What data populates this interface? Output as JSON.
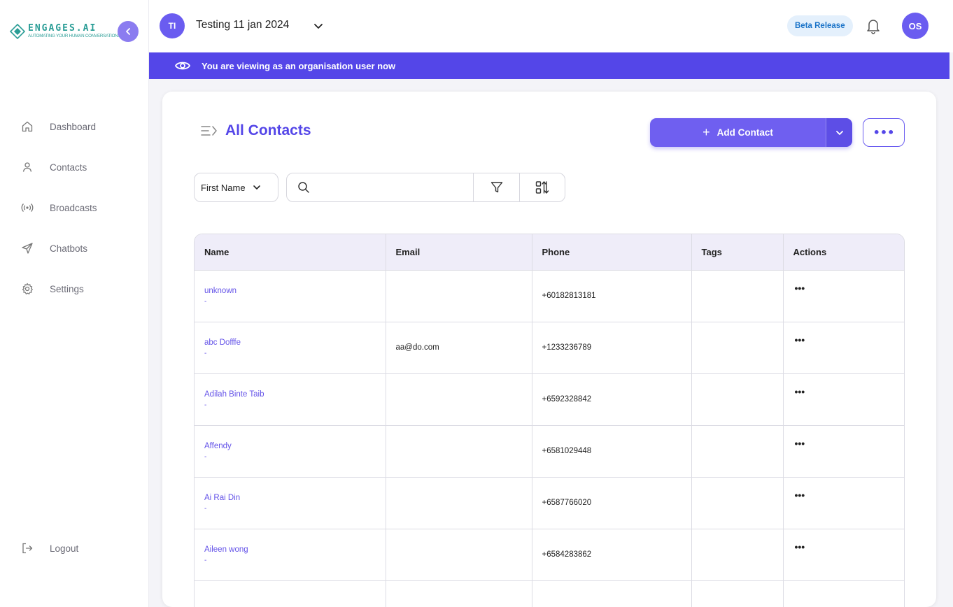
{
  "brand": {
    "name": "ENGAGES.AI",
    "tagline": "AUTOMATING YOUR HUMAN CONVERSATIONS",
    "accent": "#2a9d96"
  },
  "sidebar": {
    "items": [
      {
        "label": "Dashboard",
        "icon": "home-icon"
      },
      {
        "label": "Contacts",
        "icon": "user-icon"
      },
      {
        "label": "Broadcasts",
        "icon": "broadcast-icon"
      },
      {
        "label": "Chatbots",
        "icon": "send-icon"
      },
      {
        "label": "Settings",
        "icon": "gear-icon"
      }
    ],
    "logout_label": "Logout"
  },
  "header": {
    "org_initials": "TI",
    "org_name": "Testing 11 jan 2024",
    "beta_label": "Beta Release",
    "user_initials": "OS"
  },
  "banner": {
    "text": "You are viewing as an organisation user now"
  },
  "page": {
    "title": "All Contacts",
    "add_label": "Add Contact",
    "more_label": "•••",
    "field_select": "First Name",
    "search_placeholder": ""
  },
  "table": {
    "columns": [
      "Name",
      "Email",
      "Phone",
      "Tags",
      "Actions"
    ],
    "rows": [
      {
        "name": "unknown",
        "sub": "-",
        "email": "",
        "phone": "+60182813181",
        "tags": "",
        "actions": "•••"
      },
      {
        "name": "abc Dofffe",
        "sub": "-",
        "email": "aa@do.com",
        "phone": "+1233236789",
        "tags": "",
        "actions": "•••"
      },
      {
        "name": "Adilah Binte Taib",
        "sub": "-",
        "email": "",
        "phone": "+6592328842",
        "tags": "",
        "actions": "•••"
      },
      {
        "name": "Affendy",
        "sub": "-",
        "email": "",
        "phone": "+6581029448",
        "tags": "",
        "actions": "•••"
      },
      {
        "name": "Ai Rai Din",
        "sub": "-",
        "email": "",
        "phone": "+6587766020",
        "tags": "",
        "actions": "•••"
      },
      {
        "name": "Aileen wong",
        "sub": "-",
        "email": "",
        "phone": "+6584283862",
        "tags": "",
        "actions": "•••"
      }
    ]
  },
  "colors": {
    "primary": "#5446e8",
    "button": "#6f5ff0",
    "link": "#6453e8",
    "beta_bg": "#e4f0fc",
    "beta_text": "#1a73c8"
  }
}
